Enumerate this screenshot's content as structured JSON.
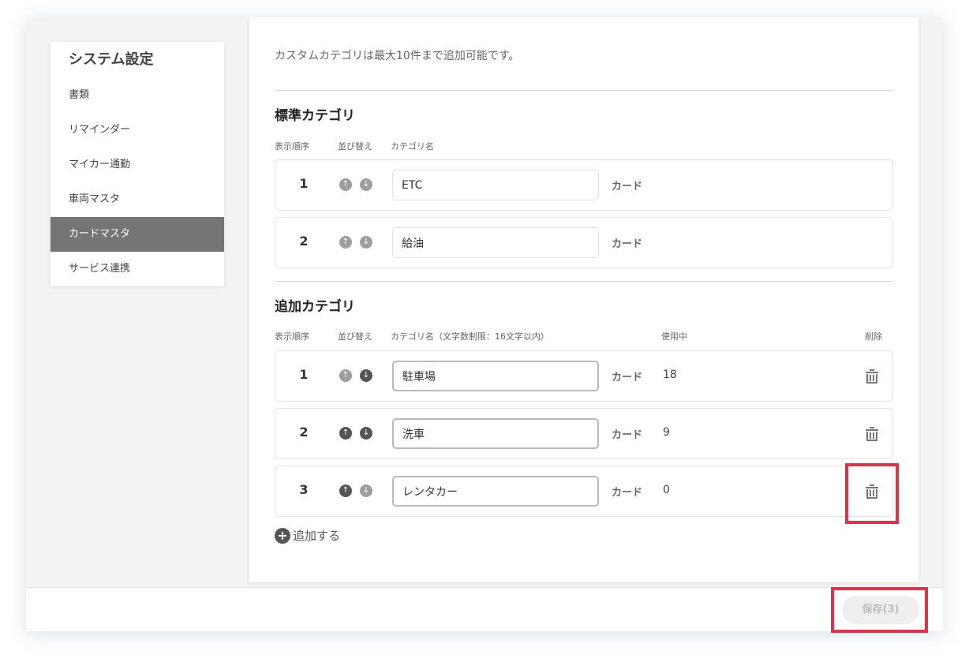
{
  "sidebar": {
    "title": "システム設定",
    "items": [
      {
        "label": "書類"
      },
      {
        "label": "リマインダー"
      },
      {
        "label": "マイカー通勤"
      },
      {
        "label": "車両マスタ"
      },
      {
        "label": "カードマスタ"
      },
      {
        "label": "サービス連携"
      }
    ],
    "active_index": 4
  },
  "main": {
    "notice": "カスタムカテゴリは最大10件まで追加可能です。",
    "standard": {
      "title": "標準カテゴリ",
      "columns": {
        "order": "表示順序",
        "sort": "並び替え",
        "name": "カテゴリ名"
      },
      "rows": [
        {
          "order": "1",
          "name": "ETC",
          "kind": "カード"
        },
        {
          "order": "2",
          "name": "給油",
          "kind": "カード"
        }
      ]
    },
    "custom": {
      "title": "追加カテゴリ",
      "columns": {
        "order": "表示順序",
        "sort": "並び替え",
        "name": "カテゴリ名（文字数制限：16文字以内）",
        "usage": "使用中",
        "delete": "削除"
      },
      "rows": [
        {
          "order": "1",
          "name": "駐車場",
          "kind": "カード",
          "usage": "18"
        },
        {
          "order": "2",
          "name": "洗車",
          "kind": "カード",
          "usage": "9"
        },
        {
          "order": "3",
          "name": "レンタカー",
          "kind": "カード",
          "usage": "0"
        }
      ]
    },
    "add_label": "追加する"
  },
  "footer": {
    "save_label": "保存(3)"
  },
  "icons": {
    "sort_up": "arrow-up-circle-icon",
    "sort_down": "arrow-down-circle-icon",
    "delete": "trash-icon",
    "add": "plus-circle-icon"
  },
  "colors": {
    "active_item": "#757575",
    "highlight": "#e0334a",
    "sort_enabled": "#555555",
    "sort_disabled": "#9e9e9e"
  }
}
